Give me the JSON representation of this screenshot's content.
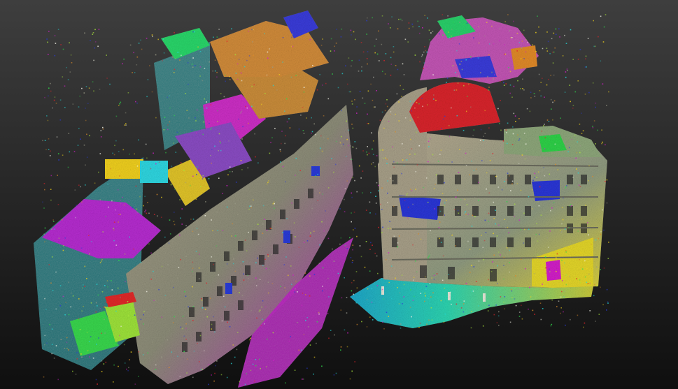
{
  "viewport": {
    "background_top": "#3e3e3e",
    "background_bottom": "#0f0f0f"
  },
  "scene": {
    "type": "colored point cloud render",
    "objects": [
      {
        "name": "left-building-block"
      },
      {
        "name": "right-building-block"
      }
    ]
  },
  "palette": {
    "magenta": "#d21ec8",
    "cyan": "#24d6d6",
    "yellow": "#f0d11b",
    "green": "#2fdc4a",
    "blue": "#2a3bd8",
    "red": "#e0242a",
    "orange": "#d98a2a",
    "grey": "#9a9a86",
    "lime": "#a8e43a",
    "white": "#efefe3"
  }
}
